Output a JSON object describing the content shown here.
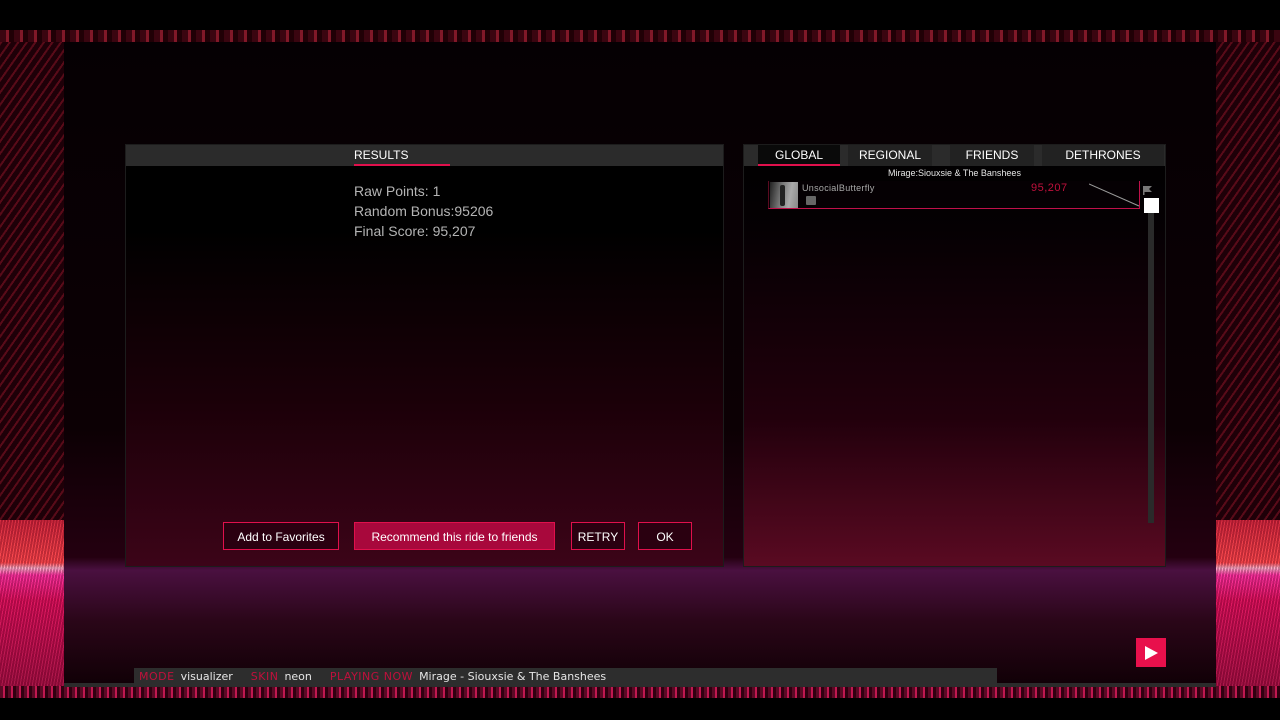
{
  "results_panel": {
    "tab_label": "RESULTS",
    "raw_points": "Raw Points: 1",
    "random_bonus": "Random Bonus:95206",
    "final_score": "Final Score: 95,207",
    "buttons": {
      "add_favorites": "Add to Favorites",
      "recommend": "Recommend this ride to friends",
      "retry": "RETRY",
      "ok": "OK"
    }
  },
  "leaderboard": {
    "tabs": [
      {
        "label": "GLOBAL",
        "active": true
      },
      {
        "label": "REGIONAL",
        "active": false
      },
      {
        "label": "FRIENDS",
        "active": false
      },
      {
        "label": "DETHRONES",
        "active": false
      }
    ],
    "song_caption": "Mirage:Siouxsie & The Banshees",
    "entries": [
      {
        "name": "UnsocialButterfly",
        "score": "95,207"
      }
    ]
  },
  "status_bar": {
    "mode_label": "MODE",
    "mode_value": "visualizer",
    "skin_label": "SKIN",
    "skin_value": "neon",
    "playing_label": "PLAYING NOW",
    "playing_value": "Mirage - Siouxsie & The Banshees"
  },
  "colors": {
    "accent": "#e0104c",
    "score": "#c0103c",
    "panel_header": "#2b2b2b"
  }
}
